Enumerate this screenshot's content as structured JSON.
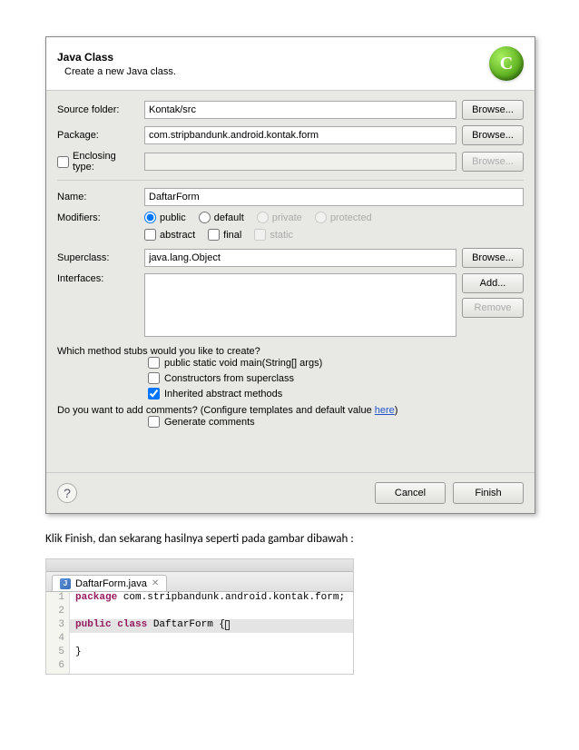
{
  "dialog": {
    "title": "Java Class",
    "subtitle": "Create a new Java class.",
    "icon_letter": "C",
    "sourceFolder": {
      "label": "Source folder:",
      "value": "Kontak/src",
      "browse": "Browse..."
    },
    "package": {
      "label": "Package:",
      "value": "com.stripbandunk.android.kontak.form",
      "browse": "Browse..."
    },
    "enclosing": {
      "label": "Enclosing type:",
      "value": "",
      "browse": "Browse..."
    },
    "name": {
      "label": "Name:",
      "value": "DaftarForm"
    },
    "modifiers": {
      "label": "Modifiers:",
      "public": "public",
      "default": "default",
      "private": "private",
      "protected": "protected",
      "abstract": "abstract",
      "final": "final",
      "static": "static"
    },
    "superclass": {
      "label": "Superclass:",
      "value": "java.lang.Object",
      "browse": "Browse..."
    },
    "interfaces": {
      "label": "Interfaces:",
      "add": "Add...",
      "remove": "Remove"
    },
    "stubs": {
      "question": "Which method stubs would you like to create?",
      "main": "public static void main(String[] args)",
      "constructors": "Constructors from superclass",
      "inherited": "Inherited abstract methods"
    },
    "comments": {
      "question_pre": "Do you want to add comments? (Configure templates and default value ",
      "here": "here",
      "question_post": ")",
      "generate": "Generate comments"
    },
    "footer": {
      "cancel": "Cancel",
      "finish": "Finish"
    }
  },
  "caption": "Klik Finish, dan sekarang hasilnya seperti pada gambar dibawah :",
  "editor": {
    "tab": {
      "icon": "J",
      "name": "DaftarForm.java",
      "close": "✕"
    },
    "lines": {
      "l1_kw": "package",
      "l1_rest": " com.stripbandunk.android.kontak.form;",
      "l3_kw": "public class",
      "l3_rest": " DaftarForm {",
      "l5": "}"
    }
  }
}
